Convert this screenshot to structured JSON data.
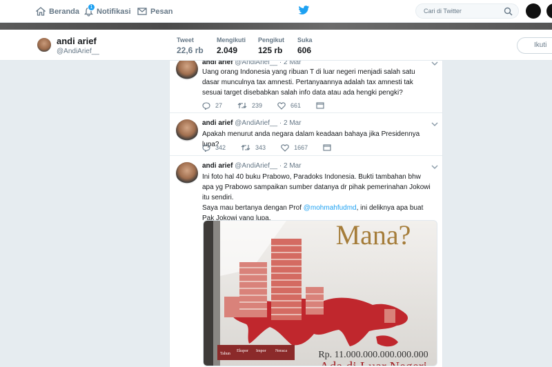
{
  "nav": {
    "home": "Beranda",
    "notifications": "Notifikasi",
    "notifications_count": "1",
    "messages": "Pesan",
    "search_placeholder": "Cari di Twitter"
  },
  "profile": {
    "name": "andi arief",
    "handle": "@AndiArief__",
    "stats": [
      {
        "label": "Tweet",
        "value": "22,6 rb"
      },
      {
        "label": "Mengikuti",
        "value": "2.049"
      },
      {
        "label": "Pengikut",
        "value": "125 rb"
      },
      {
        "label": "Suka",
        "value": "606"
      }
    ],
    "follow_label": "Ikuti"
  },
  "tweets": [
    {
      "name": "andi arief",
      "handle": "@AndiArief__",
      "date": "2 Mar",
      "text": "Uang orang Indonesia yang ribuan T di luar negeri menjadi salah satu dasar munculnya tax amnesti. Pertanyaannya adalah tax amnesti tak sesuai target disebabkan salah info data atau ada hengki pengki?",
      "replies": "27",
      "retweets": "239",
      "likes": "661"
    },
    {
      "name": "andi arief",
      "handle": "@AndiArief__",
      "date": "2 Mar",
      "text": "Apakah menurut anda negara dalam keadaan bahaya jika Presidennya lupa?",
      "replies": "342",
      "retweets": "343",
      "likes": "1667"
    },
    {
      "name": "andi arief",
      "handle": "@AndiArief__",
      "date": "2 Mar",
      "text1": "Ini foto hal 40 buku Prabowo, Paradoks Indonesia. Bukti tambahan bhw apa yg Prabowo sampaikan sumber datanya dr pihak pemerinahan Jokowi itu sendiri.",
      "text2_a": "Saya mau bertanya dengan Prof ",
      "text2_mention": "@mohmahfudmd",
      "text2_b": ", ini deliknya apa buat Pak Jokowi yang lupa.",
      "image": {
        "headline": "Mana?",
        "amount": "Rp. 11.000.000.000.000.000",
        "caption": "Ada di Luar Negeri",
        "table_headers": [
          "Tahun",
          "Ekspor",
          "Impor",
          "Neraca"
        ]
      }
    }
  ],
  "colors": {
    "accent": "#1da1f2",
    "background": "#e6ecf0",
    "muted": "#657786"
  }
}
